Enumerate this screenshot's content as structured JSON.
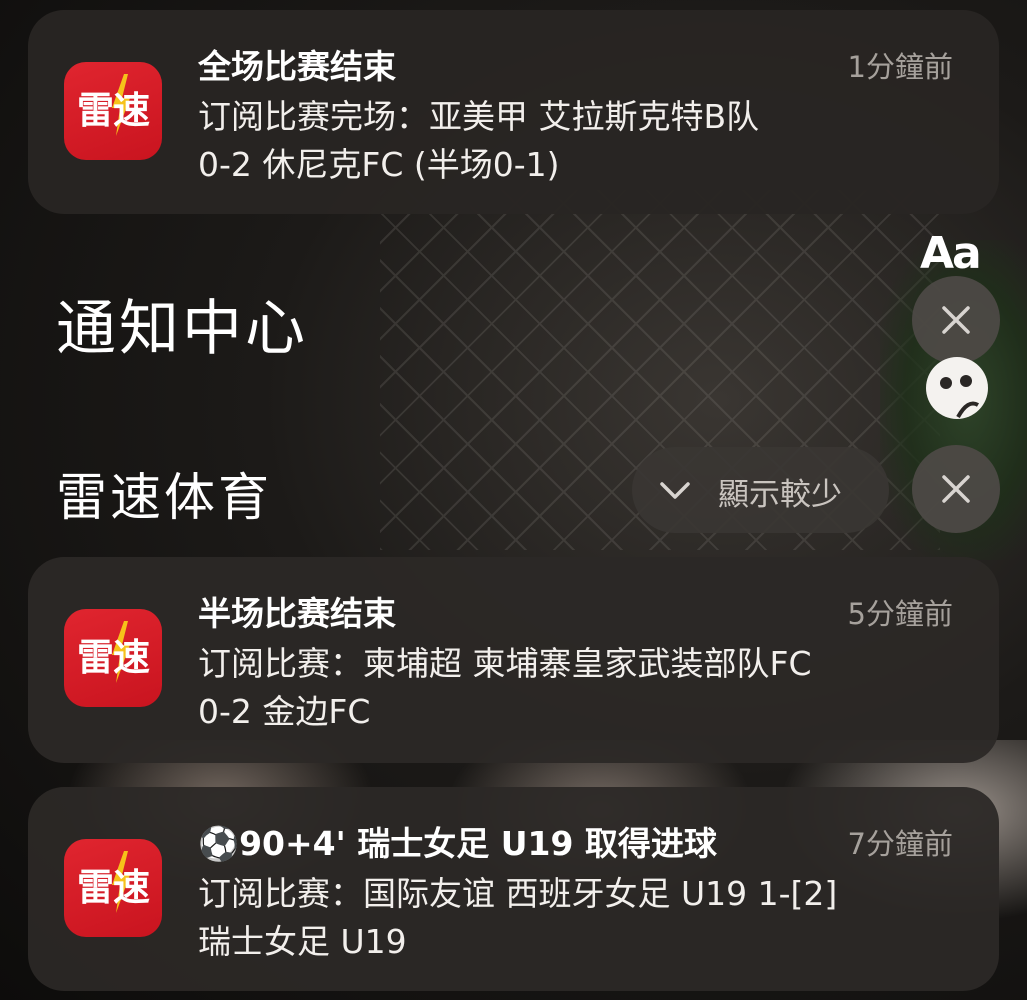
{
  "background": {
    "accent": "#2c2826"
  },
  "notification_center": {
    "title": "通知中心",
    "text_size_label": "Aa"
  },
  "top_notification": {
    "app_icon_text": "雷速",
    "title": "全场比赛结束",
    "time": "1分鐘前",
    "line1": "订阅比赛完场：亚美甲 艾拉斯克特B队",
    "line2": "0-2 休尼克FC (半场0-1)"
  },
  "group": {
    "name": "雷速体育",
    "show_less_label": "顯示較少",
    "notifications": [
      {
        "app_icon_text": "雷速",
        "title": "半场比赛结束",
        "time": "5分鐘前",
        "line1": "订阅比赛：柬埔超 柬埔寨皇家武装部队FC",
        "line2": "0-2 金边FC"
      },
      {
        "app_icon_text": "雷速",
        "title": "⚽90+4' 瑞士女足 U19 取得进球",
        "time": "7分鐘前",
        "line1": "订阅比赛：国际友谊 西班牙女足 U19 1-[2]",
        "line2": "瑞士女足 U19"
      }
    ]
  },
  "colors": {
    "app_icon_red": "#d91c27",
    "bolt_yellow": "#f6c21a",
    "card_bg": "#2c2826"
  }
}
